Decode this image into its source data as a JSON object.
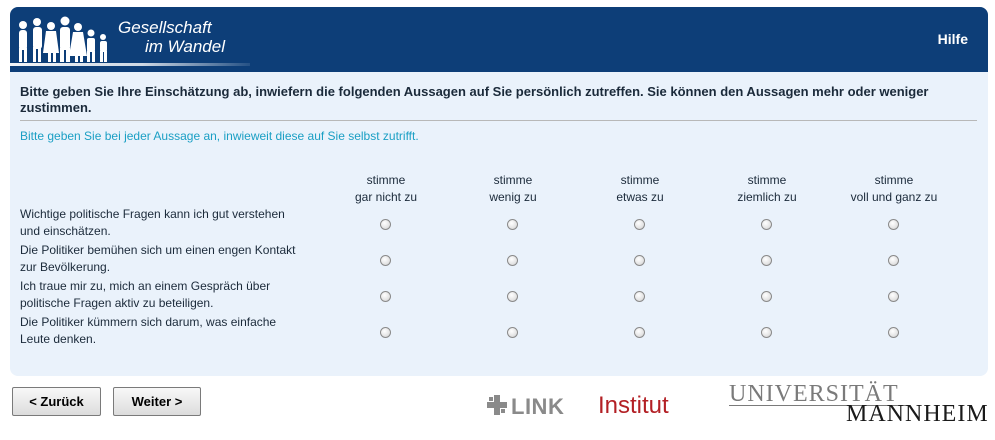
{
  "header": {
    "logo_line1": "Gesellschaft",
    "logo_line2": "im Wandel",
    "help_label": "Hilfe"
  },
  "intro_text": "Bitte geben Sie Ihre Einschätzung ab, inwiefern die folgenden Aussagen auf Sie persönlich zutreffen. Sie können den Aussagen mehr oder weniger zustimmen.",
  "instruction_text": "Bitte geben Sie bei jeder Aussage an, inwieweit diese auf Sie selbst zutrifft.",
  "columns": [
    {
      "line1": "stimme",
      "line2": "gar nicht zu"
    },
    {
      "line1": "stimme",
      "line2": "wenig zu"
    },
    {
      "line1": "stimme",
      "line2": "etwas zu"
    },
    {
      "line1": "stimme",
      "line2": "ziemlich zu"
    },
    {
      "line1": "stimme",
      "line2": "voll und ganz zu"
    }
  ],
  "rows": [
    {
      "line1": "Wichtige politische Fragen kann ich gut verstehen",
      "line2": "und einschätzen."
    },
    {
      "line1": "Die Politiker bemühen sich um einen engen Kontakt",
      "line2": "zur Bevölkerung."
    },
    {
      "line1": "Ich traue mir zu, mich an einem Gespräch über",
      "line2": "politische Fragen aktiv zu beteiligen."
    },
    {
      "line1": "Die Politiker kümmern sich darum, was einfache",
      "line2": "Leute denken."
    }
  ],
  "buttons": {
    "back_label": "< Zurück",
    "next_label": "Weiter >"
  },
  "footer": {
    "link_word": "LINK",
    "link_institut": "Institut",
    "uni_line1": "UNIVERSITÄT",
    "uni_line2": "MANNHEIM"
  },
  "colors": {
    "header_bg": "#0d3e78",
    "panel_bg": "#eaf2fb",
    "instruction": "#1a9fc4",
    "link_red": "#b32025"
  }
}
